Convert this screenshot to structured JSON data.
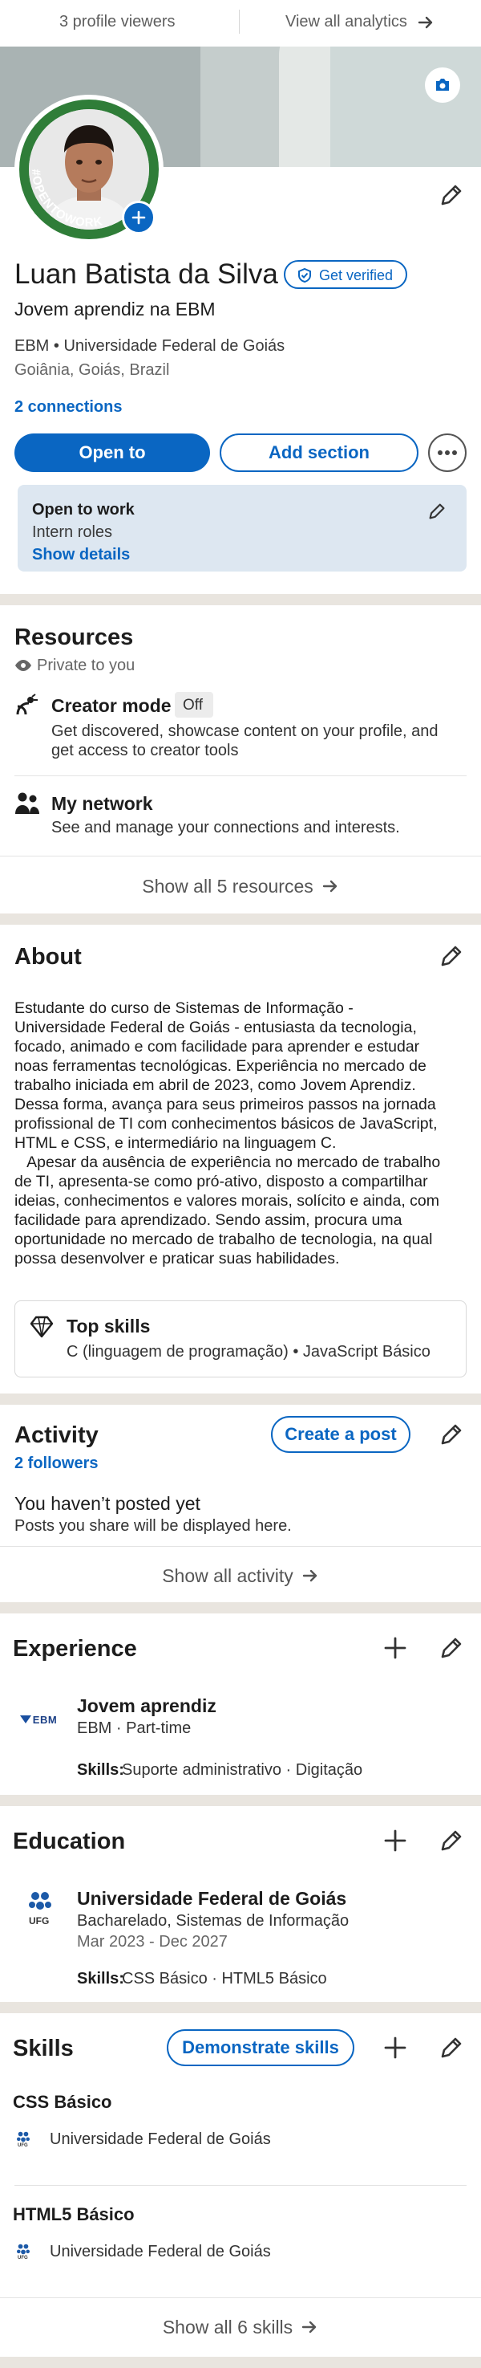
{
  "analytics_bar": {
    "viewers": "3 profile viewers",
    "view_all": "View all analytics"
  },
  "profile": {
    "banner_badge": "#OPENTOWORK",
    "name": "Luan Batista da Silva",
    "verify_label": "Get verified",
    "headline": "Jovem aprendiz na EBM",
    "org_line": "EBM • Universidade Federal de Goiás",
    "location": "Goiânia, Goiás, Brazil",
    "connections": "2 connections",
    "open_to_label": "Open to",
    "add_section_label": "Add section",
    "more_label": "…"
  },
  "open_to_work": {
    "title": "Open to work",
    "roles": "Intern roles",
    "show_details": "Show details"
  },
  "resources": {
    "title": "Resources",
    "private": "Private to you",
    "creator_title": "Creator mode",
    "creator_status": "Off",
    "creator_desc_1": "Get discovered, showcase content on your profile, and",
    "creator_desc_2": "get access to creator tools",
    "network_title": "My network",
    "network_desc": "See and manage your connections and interests.",
    "show_all": "Show all 5 resources"
  },
  "about": {
    "title": "About",
    "lines": [
      "Estudante do curso de Sistemas de Informação -",
      "Universidade Federal de Goiás - entusiasta da tecnologia,",
      "focado, animado e com facilidade para aprender e estudar",
      "noas ferramentas tecnológicas. Experiência no mercado de",
      "trabalho iniciada em abril de 2023, como Jovem Aprendiz.",
      "Dessa forma, avança para seus primeiros passos na jornada",
      "profissional de TI com conhecimentos básicos de JavaScript,",
      "HTML e CSS, e intermediário na linguagem C.",
      "   Apesar da ausência de experiência no mercado de trabalho",
      "de TI, apresenta-se como pró-ativo, disposto a compartilhar",
      "ideias, conhecimentos e valores morais, solícito e ainda, com",
      "facilidade para aprendizado. Sendo assim, procura uma",
      "oportunidade no mercado de trabalho de tecnologia, na qual",
      "possa desenvolver e praticar suas habilidades."
    ],
    "top_skills_title": "Top skills",
    "top_skills_value": "C (linguagem de programação) • JavaScript Básico"
  },
  "activity": {
    "title": "Activity",
    "followers": "2 followers",
    "create_post": "Create a post",
    "empty_title": "You haven’t posted yet",
    "empty_desc": "Posts you share will be displayed here.",
    "show_all": "Show all activity"
  },
  "experience": {
    "title": "Experience",
    "role": "Jovem aprendiz",
    "company_line": "EBM · Part-time",
    "logo_text": "EBM",
    "skills_label": "Skills:",
    "skills": " Suporte administrativo · Digitação"
  },
  "education": {
    "title": "Education",
    "school": "Universidade Federal de Goiás",
    "degree": "Bacharelado, Sistemas de Informação",
    "dates": "Mar 2023 - Dec 2027",
    "logo_text": "UFG",
    "skills_label": "Skills:",
    "skills": " CSS Básico · HTML5 Básico"
  },
  "skills": {
    "title": "Skills",
    "demonstrate": "Demonstrate skills",
    "items": [
      {
        "name": "CSS Básico",
        "source": "Universidade Federal de Goiás"
      },
      {
        "name": "HTML5 Básico",
        "source": "Universidade Federal de Goiás"
      }
    ],
    "logo_text": "UFG",
    "show_all": "Show all 6 skills"
  },
  "colors": {
    "accent": "#0a66c2",
    "banner_gray": "#a8b3b3",
    "open_to_work_bg": "#dde7f1",
    "open_to_work_ring": "#2f7d38",
    "separator": "#e9e5df"
  }
}
